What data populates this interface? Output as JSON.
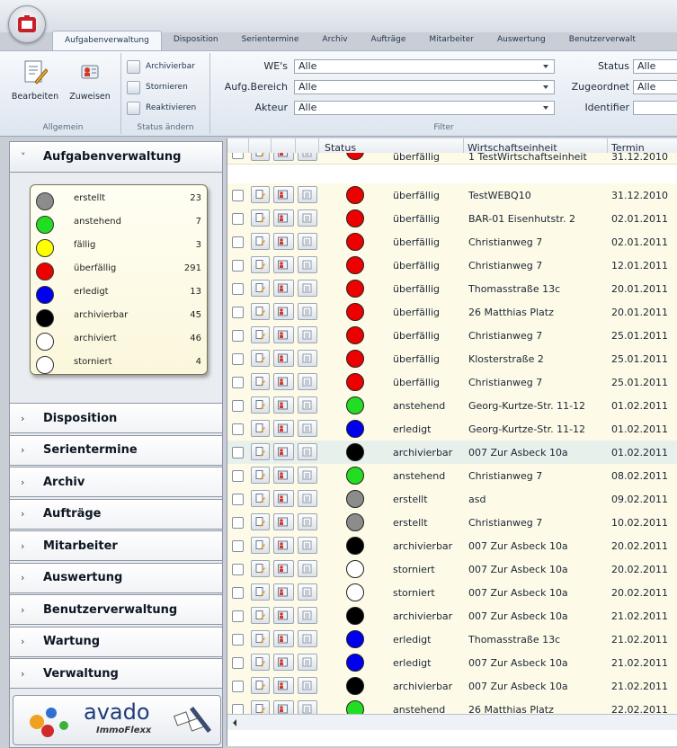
{
  "ribbon": {
    "tabs": [
      {
        "label": "Aufgabenverwaltung",
        "active": true
      },
      {
        "label": "Disposition",
        "active": false
      },
      {
        "label": "Serientermine",
        "active": false
      },
      {
        "label": "Archiv",
        "active": false
      },
      {
        "label": "Aufträge",
        "active": false
      },
      {
        "label": "Mitarbeiter",
        "active": false
      },
      {
        "label": "Auswertung",
        "active": false
      },
      {
        "label": "Benutzerverwalt",
        "active": false
      }
    ],
    "groups": {
      "allgemein": {
        "label": "Allgemein",
        "bearbeiten": "Bearbeiten",
        "zuweisen": "Zuweisen"
      },
      "status": {
        "label": "Status ändern",
        "archivierbar": "Archivierbar",
        "stornieren": "Stornieren",
        "reaktivieren": "Reaktivieren"
      },
      "filter": {
        "label": "Filter",
        "we_label": "WE's",
        "we_value": "Alle",
        "bereich_label": "Aufg.Bereich",
        "bereich_value": "Alle",
        "akteur_label": "Akteur",
        "akteur_value": "Alle",
        "status_label": "Status",
        "status_value": "Alle",
        "zugeordnet_label": "Zugeordnet",
        "zugeordnet_value": "Alle",
        "identifier_label": "Identifier",
        "identifier_value": ""
      }
    }
  },
  "nav": {
    "expanded": "Aufgabenverwaltung",
    "sections": [
      "Disposition",
      "Serientermine",
      "Archiv",
      "Aufträge",
      "Mitarbeiter",
      "Auswertung",
      "Benutzerverwaltung",
      "Wartung",
      "Verwaltung"
    ],
    "legend": [
      {
        "name": "erstellt",
        "count": "23",
        "color": "#8c8c8c"
      },
      {
        "name": "anstehend",
        "count": "7",
        "color": "#22dd22"
      },
      {
        "name": "fällig",
        "count": "3",
        "color": "#ffff00"
      },
      {
        "name": "überfällig",
        "count": "291",
        "color": "#ee0000"
      },
      {
        "name": "erledigt",
        "count": "13",
        "color": "#0000ee"
      },
      {
        "name": "archivierbar",
        "count": "45",
        "color": "#000000"
      },
      {
        "name": "archiviert",
        "count": "46",
        "color": "#ffffff"
      },
      {
        "name": "storniert",
        "count": "4",
        "color": "#ffffff"
      }
    ],
    "logo_text": "avado",
    "logo_sub": "ImmoFlexx"
  },
  "grid": {
    "columns": {
      "status": "Status",
      "we": "Wirtschaftseinheit",
      "termin": "Termin"
    },
    "status_colors": {
      "überfällig": "#ee0000",
      "anstehend": "#22dd22",
      "erledigt": "#0000ee",
      "archivierbar": "#000000",
      "erstellt": "#8c8c8c",
      "storniert": "#ffffff"
    },
    "rows": [
      {
        "status": "überfällig",
        "we": "1 TestWirtschaftseinheit",
        "termin": "31.12.2010"
      },
      {
        "status": "überfällig",
        "we": "TestWEBQ10",
        "termin": "31.12.2010"
      },
      {
        "status": "überfällig",
        "we": "BAR-01 Eisenhutstr. 2",
        "termin": "02.01.2011"
      },
      {
        "status": "überfällig",
        "we": "Christianweg 7",
        "termin": "02.01.2011"
      },
      {
        "status": "überfällig",
        "we": "Christianweg 7",
        "termin": "12.01.2011"
      },
      {
        "status": "überfällig",
        "we": "Thomasstraße 13c",
        "termin": "20.01.2011"
      },
      {
        "status": "überfällig",
        "we": "26 Matthias Platz",
        "termin": "20.01.2011"
      },
      {
        "status": "überfällig",
        "we": "Christianweg 7",
        "termin": "25.01.2011"
      },
      {
        "status": "überfällig",
        "we": "Klosterstraße 2",
        "termin": "25.01.2011"
      },
      {
        "status": "überfällig",
        "we": "Christianweg 7",
        "termin": "25.01.2011"
      },
      {
        "status": "anstehend",
        "we": "Georg-Kurtze-Str. 11-12",
        "termin": "01.02.2011"
      },
      {
        "status": "erledigt",
        "we": "Georg-Kurtze-Str. 11-12",
        "termin": "01.02.2011"
      },
      {
        "status": "archivierbar",
        "we": "007 Zur Asbeck 10a",
        "termin": "01.02.2011",
        "selected": true
      },
      {
        "status": "anstehend",
        "we": "Christianweg 7",
        "termin": "08.02.2011"
      },
      {
        "status": "erstellt",
        "we": "asd",
        "termin": "09.02.2011"
      },
      {
        "status": "erstellt",
        "we": "Christianweg 7",
        "termin": "10.02.2011"
      },
      {
        "status": "archivierbar",
        "we": "007 Zur Asbeck 10a",
        "termin": "20.02.2011"
      },
      {
        "status": "storniert",
        "we": "007 Zur Asbeck 10a",
        "termin": "20.02.2011"
      },
      {
        "status": "storniert",
        "we": "007 Zur Asbeck 10a",
        "termin": "20.02.2011"
      },
      {
        "status": "archivierbar",
        "we": "007 Zur Asbeck 10a",
        "termin": "21.02.2011"
      },
      {
        "status": "erledigt",
        "we": "Thomasstraße 13c",
        "termin": "21.02.2011"
      },
      {
        "status": "erledigt",
        "we": "007 Zur Asbeck 10a",
        "termin": "21.02.2011"
      },
      {
        "status": "archivierbar",
        "we": "007 Zur Asbeck 10a",
        "termin": "21.02.2011"
      },
      {
        "status": "anstehend",
        "we": "26 Matthias Platz",
        "termin": "22.02.2011"
      }
    ]
  }
}
